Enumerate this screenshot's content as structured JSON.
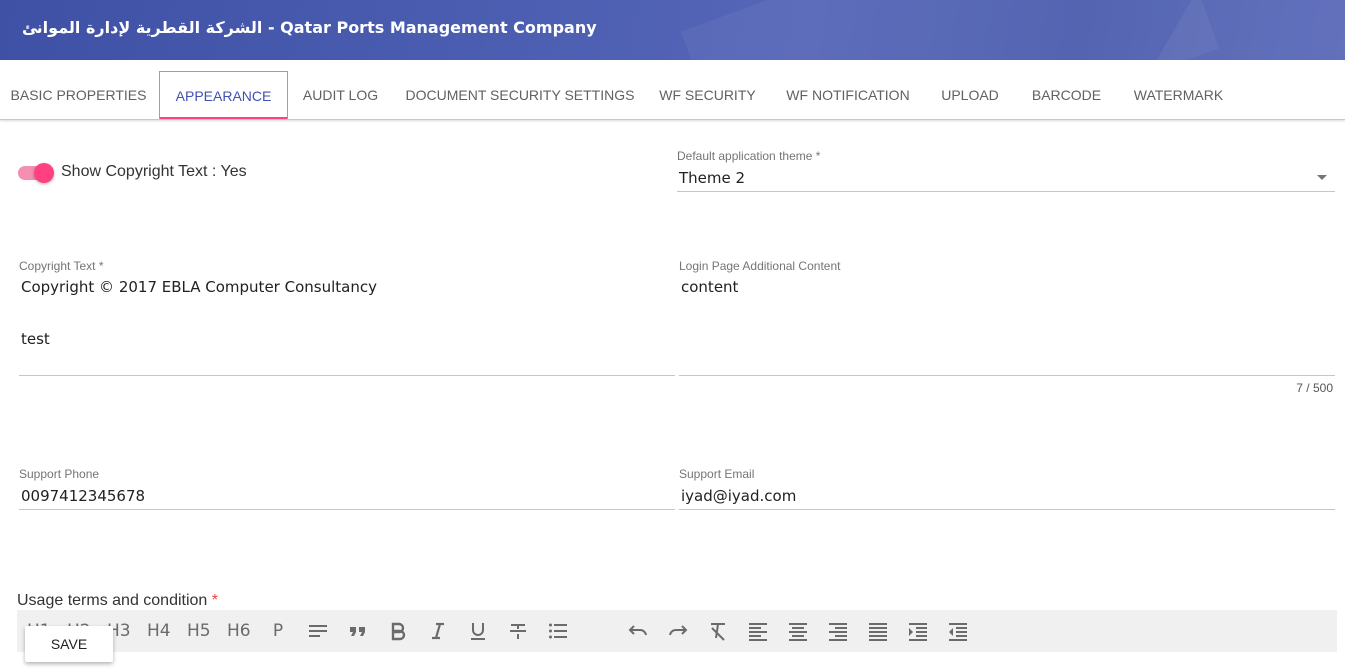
{
  "header": {
    "title": "الشركة القطرية لإدارة الموانئ - Qatar Ports Management Company"
  },
  "tabs": [
    {
      "label": "BASIC PROPERTIES"
    },
    {
      "label": "APPEARANCE"
    },
    {
      "label": "AUDIT LOG"
    },
    {
      "label": "DOCUMENT SECURITY SETTINGS"
    },
    {
      "label": "WF SECURITY"
    },
    {
      "label": "WF NOTIFICATION"
    },
    {
      "label": "UPLOAD"
    },
    {
      "label": "BARCODE"
    },
    {
      "label": "WATERMARK"
    }
  ],
  "active_tab": "APPEARANCE",
  "form": {
    "show_copyright_label": "Show Copyright Text : Yes",
    "show_copyright_on": true,
    "theme_label": "Default application theme *",
    "theme_value": "Theme 2",
    "copyright_label": "Copyright Text *",
    "copyright_value_line1": "Copyright © 2017 EBLA Computer Consultancy",
    "copyright_value_line2": "test",
    "login_content_label": "Login Page Additional Content",
    "login_content_value": "content",
    "login_content_counter": "7 / 500",
    "support_phone_label": "Support Phone",
    "support_phone_value": "0097412345678",
    "support_email_label": "Support Email",
    "support_email_value": "iyad@iyad.com",
    "usage_terms_label": "Usage terms and condition",
    "usage_terms_required": "*"
  },
  "editor_toolbar": {
    "headings": [
      "H1",
      "H2",
      "H3",
      "H4",
      "H5",
      "H6",
      "P"
    ],
    "icons": [
      "paragraph-align-icon",
      "quote-icon",
      "bold-icon",
      "italic-icon",
      "underline-icon",
      "strikethrough-icon",
      "bullet-list-icon",
      "undo-icon",
      "redo-icon",
      "clear-format-icon",
      "align-left-icon",
      "align-center-icon",
      "align-right-icon",
      "align-justify-icon",
      "indent-icon",
      "outdent-icon"
    ]
  },
  "save_button": {
    "label": "SAVE"
  },
  "colors": {
    "header": "#3f51a5",
    "accent": "#ff4081",
    "active_tab_text": "#3f51b5"
  }
}
